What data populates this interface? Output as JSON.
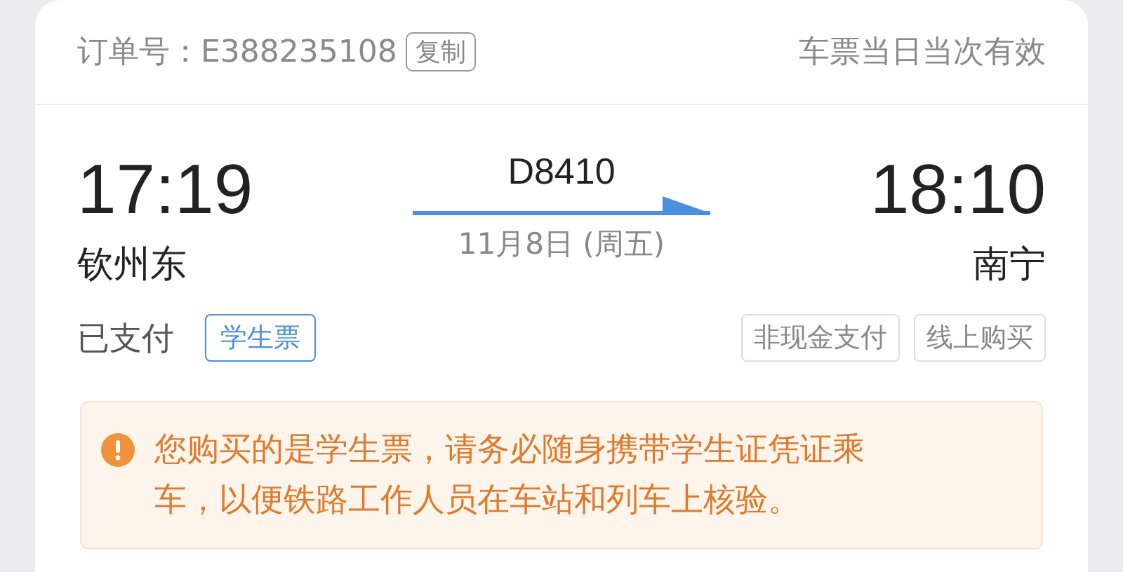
{
  "header": {
    "order_label": "订单号：E388235108",
    "copy_button": "复制",
    "validity": "车票当日当次有效"
  },
  "trip": {
    "depart_time": "17:19",
    "depart_station": "钦州东",
    "train": "D8410",
    "date": "11月8日 (周五)",
    "arrive_time": "18:10",
    "arrive_station": "南宁"
  },
  "status": {
    "payment": "已支付",
    "ticket_type": "学生票",
    "tags": [
      "非现金支付",
      "线上购买"
    ]
  },
  "notice": {
    "text": "您购买的是学生票，请务必随身携带学生证凭证乘车，以便铁路工作人员在车站和列车上核验。"
  }
}
